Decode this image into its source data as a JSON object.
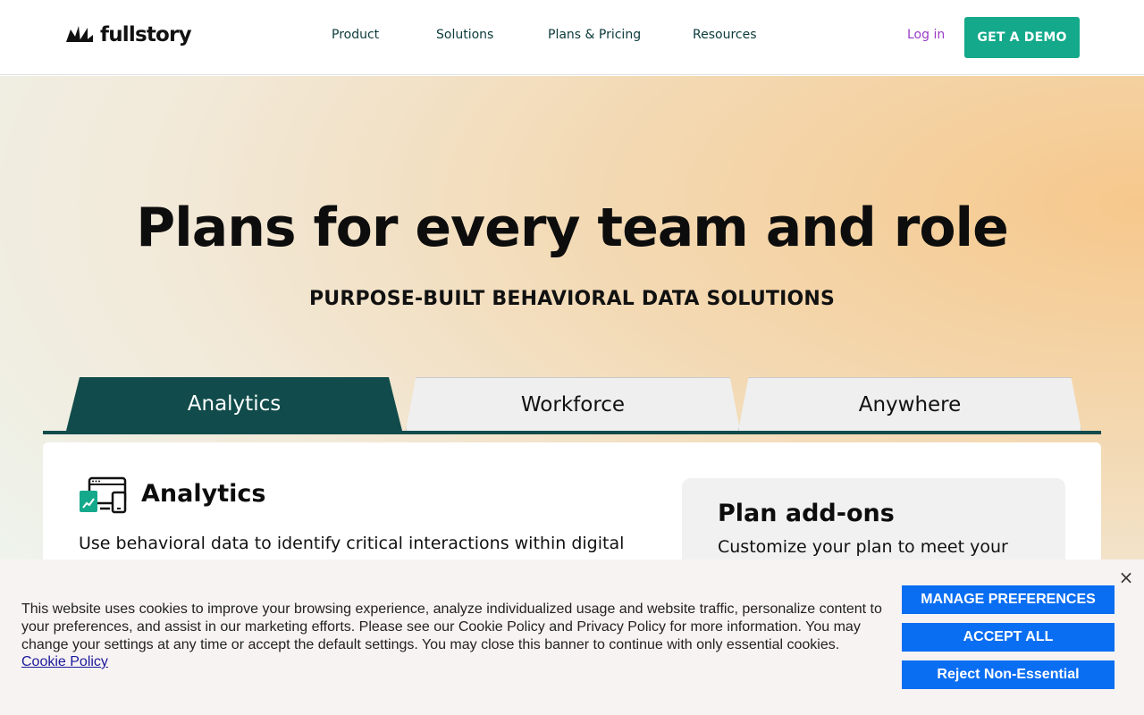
{
  "header": {
    "logo_text": "fullstory",
    "nav": [
      "Product",
      "Solutions",
      "Plans & Pricing",
      "Resources"
    ],
    "login": "Log in",
    "demo": "GET A DEMO"
  },
  "hero": {
    "title": "Plans for every team and role",
    "subtitle": "PURPOSE-BUILT BEHAVIORAL DATA SOLUTIONS"
  },
  "tabs": [
    "Analytics",
    "Workforce",
    "Anywhere"
  ],
  "panel": {
    "title": "Analytics",
    "description": "Use behavioral data to identify critical interactions within digital",
    "addons_title": "Plan add-ons",
    "addons_description": "Customize your plan to meet your"
  },
  "cookie": {
    "text": "This website uses cookies to improve your browsing experience, analyze individualized usage and website traffic, personalize content to your preferences, and assist in our marketing efforts. Please see our Cookie Policy and Privacy Policy for more information. You may change your settings at any time or accept the default settings. You may close this banner to continue with only essential cookies.",
    "link": "Cookie Policy",
    "manage": "MANAGE PREFERENCES",
    "accept": "ACCEPT ALL",
    "reject": "Reject Non-Essential",
    "close_symbol": "×"
  },
  "colors": {
    "teal_dark": "#114b4b",
    "demo_green": "#14a98b",
    "login_purple": "#9b3cc8",
    "cookie_blue": "#0a6ef2"
  }
}
